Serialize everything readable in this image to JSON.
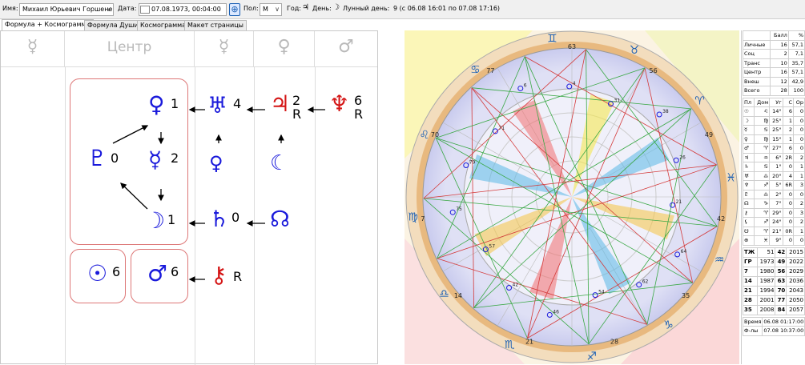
{
  "toolbar": {
    "name_label": "Имя:",
    "name_value": "Михаил Юрьевич Горшене",
    "date_label": "Дата:",
    "date_value": "07.08.1973, 00:04:00",
    "sex_label": "Пол:",
    "sex_value": "М",
    "year_label": "Год:",
    "year_symbol": "♃",
    "day_label": "День:",
    "day_symbol": "☽",
    "lunar_label": "Лунный день:",
    "lunar_value": "9 (с 06.08 16:01 по 07.08 17:16)"
  },
  "tabs": [
    "Формула + Космограмма",
    "Формула Души",
    "Космограмма",
    "Макет страницы"
  ],
  "formula": {
    "headers": [
      "☿",
      "Центр",
      "☿",
      "♀",
      "♂"
    ],
    "planets": [
      {
        "glyph": "♀",
        "num": "1",
        "color": "blue"
      },
      {
        "glyph": "♅",
        "num": "4",
        "color": "blue"
      },
      {
        "glyph": "♃",
        "num": "2",
        "sub": "R",
        "color": "red"
      },
      {
        "glyph": "♆",
        "num": "6",
        "sub": "R",
        "color": "red"
      },
      {
        "glyph": "♇",
        "num": "0",
        "color": "blue"
      },
      {
        "glyph": "☿",
        "num": "2",
        "color": "blue"
      },
      {
        "glyph": "♀",
        "num": "",
        "color": "blue"
      },
      {
        "glyph": "☾",
        "num": "",
        "color": "blue"
      },
      {
        "glyph": "☽",
        "num": "1",
        "color": "blue"
      },
      {
        "glyph": "♄",
        "num": "0",
        "color": "blue"
      },
      {
        "glyph": "☊",
        "num": "",
        "color": "blue"
      },
      {
        "glyph": "☉",
        "num": "6",
        "color": "blue"
      },
      {
        "glyph": "♂",
        "num": "6",
        "color": "blue"
      },
      {
        "glyph": "⚷",
        "num": "",
        "sub": "R",
        "color": "red"
      }
    ]
  },
  "chart": {
    "degree_labels": [
      "63",
      "56",
      "49",
      "42",
      "35",
      "28",
      "21",
      "14",
      "7",
      "70",
      "77"
    ],
    "zodiac": [
      "♉",
      "♈",
      "♓",
      "♒",
      "♑",
      "♐",
      "♏",
      "♎",
      "♍",
      "♌",
      "♋",
      "♊"
    ],
    "planet_labels": [
      "64",
      "62",
      "54",
      "46",
      "42",
      "57",
      "75",
      "79",
      "71",
      "6",
      "4",
      "31",
      "38",
      "26",
      "21"
    ]
  },
  "stats": {
    "header": [
      "",
      "Балл",
      "%"
    ],
    "rows": [
      [
        "Личные",
        "16",
        "57,1"
      ],
      [
        "Соц",
        "2",
        "7,1"
      ],
      [
        "Транс",
        "10",
        "35,7"
      ],
      [
        "Центр",
        "16",
        "57,1"
      ],
      [
        "Внеш",
        "12",
        "42,9"
      ],
      [
        "Всего",
        "28",
        "100"
      ]
    ],
    "plan_header": [
      "Пл",
      "Дом",
      "Уг",
      "С",
      "Ор"
    ],
    "plan_rows": [
      [
        "☉",
        "♌",
        "14°",
        "6",
        "0"
      ],
      [
        "☽",
        "♍",
        "25°",
        "1",
        "0"
      ],
      [
        "☿",
        "♋",
        "25°",
        "2",
        "0"
      ],
      [
        "♀",
        "♍",
        "15°",
        "1",
        "0"
      ],
      [
        "♂",
        "♈",
        "27°",
        "6",
        "0"
      ],
      [
        "♃",
        "♒",
        "6°",
        "2R",
        "2"
      ],
      [
        "♄",
        "♋",
        "1°",
        "0",
        "1"
      ],
      [
        "♅",
        "♎",
        "20°",
        "4",
        "1"
      ],
      [
        "♆",
        "♐",
        "5°",
        "6R",
        "3"
      ],
      [
        "♇",
        "♎",
        "2°",
        "0",
        "0"
      ],
      [
        "☊",
        "♑",
        "7°",
        "0",
        "2"
      ],
      [
        "⚷",
        "♈",
        "29°",
        "0",
        "3"
      ],
      [
        "⚸",
        "♐",
        "24°",
        "0",
        "2"
      ],
      [
        "☋",
        "♈",
        "21°",
        "0R",
        "1"
      ],
      [
        "⊕",
        "♓",
        "9°",
        "0",
        "0"
      ]
    ],
    "years": [
      [
        "ТЖ",
        "51",
        "42",
        "2015"
      ],
      [
        "ГР",
        "1973",
        "49",
        "2022"
      ],
      [
        "7",
        "1980",
        "56",
        "2029"
      ],
      [
        "14",
        "1987",
        "63",
        "2036"
      ],
      [
        "21",
        "1994",
        "70",
        "2043"
      ],
      [
        "28",
        "2001",
        "77",
        "2050"
      ],
      [
        "35",
        "2008",
        "84",
        "2057"
      ]
    ],
    "time_rows": [
      [
        "Время",
        "06.08 01:17:00"
      ],
      [
        "Ф-лы",
        "07.08 10:37:00"
      ]
    ]
  }
}
